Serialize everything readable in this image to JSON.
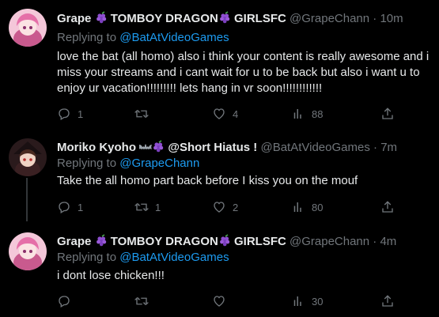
{
  "tweets": [
    {
      "name_part1": "Grape ",
      "name_part2": " TOMBOY DRAGON",
      "name_part3": " GIRLSFC",
      "handle": "@GrapeChann",
      "sep": " · ",
      "time": "10m",
      "replying_label": "Replying to ",
      "replying_to": "@BatAtVideoGames",
      "text": "love the bat (all homo) also i think your content is really awesome and i miss your streams and i cant wait for u to be back but also i want u to enjoy ur vacation!!!!!!!!! lets hang in vr soon!!!!!!!!!!!!",
      "replies": "1",
      "retweets": "",
      "likes": "4",
      "views": "88"
    },
    {
      "name_part1": "Moriko Kyoho ",
      "name_part2": " @Short Hiatus !",
      "handle": "@BatAtVideoGames",
      "sep": " · ",
      "time": "7m",
      "replying_label": "Replying to ",
      "replying_to": "@GrapeChann",
      "text": "Take the all homo part back before I kiss you on the mouf",
      "replies": "1",
      "retweets": "1",
      "likes": "2",
      "views": "80"
    },
    {
      "name_part1": "Grape ",
      "name_part2": " TOMBOY DRAGON",
      "name_part3": " GIRLSFC",
      "handle": "@GrapeChann",
      "sep": " · ",
      "time": "4m",
      "replying_label": "Replying to ",
      "replying_to": "@BatAtVideoGames",
      "text": "i dont lose chicken!!!",
      "replies": "",
      "retweets": "",
      "likes": "",
      "views": "30"
    }
  ],
  "colors": {
    "background": "#000000",
    "text": "#e7e9ea",
    "muted": "#71767b",
    "link": "#1d9bf0",
    "grape_emoji": "#8e4fd1"
  },
  "icons": [
    "reply-icon",
    "retweet-icon",
    "like-icon",
    "views-icon",
    "share-icon",
    "grape-emoji-icon",
    "bat-emoji-icon"
  ]
}
